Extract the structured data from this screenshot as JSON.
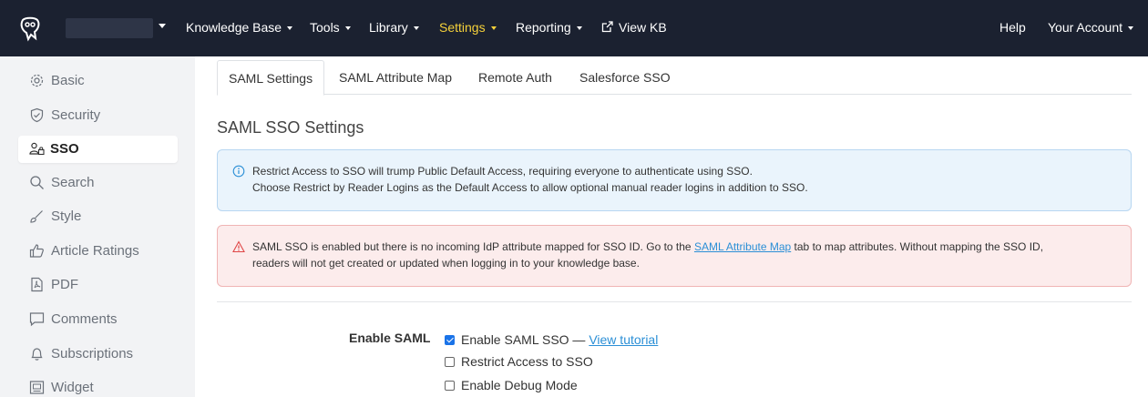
{
  "nav": {
    "items": [
      {
        "label": "Knowledge Base",
        "dropdown": true
      },
      {
        "label": "Tools",
        "dropdown": true
      },
      {
        "label": "Library",
        "dropdown": true
      },
      {
        "label": "Settings",
        "dropdown": true
      },
      {
        "label": "Reporting",
        "dropdown": true
      },
      {
        "label": "View KB",
        "icon": "external-link-icon"
      }
    ],
    "help": "Help",
    "account": "Your Account",
    "active_color": "#f5d13a",
    "background": "#1b2130"
  },
  "sidebar": {
    "items": [
      {
        "label": "Basic",
        "icon": "gear-icon"
      },
      {
        "label": "Security",
        "icon": "shield-check-icon"
      },
      {
        "label": "SSO",
        "icon": "users-lock-icon"
      },
      {
        "label": "Search",
        "icon": "search-icon"
      },
      {
        "label": "Style",
        "icon": "brush-icon"
      },
      {
        "label": "Article Ratings",
        "icon": "thumbs-up-icon"
      },
      {
        "label": "PDF",
        "icon": "pdf-icon"
      },
      {
        "label": "Comments",
        "icon": "comment-icon"
      },
      {
        "label": "Subscriptions",
        "icon": "bell-icon"
      },
      {
        "label": "Widget",
        "icon": "widget-icon"
      }
    ],
    "active": "SSO"
  },
  "tabs": [
    {
      "label": "SAML Settings"
    },
    {
      "label": "SAML Attribute Map"
    },
    {
      "label": "Remote Auth"
    },
    {
      "label": "Salesforce SSO"
    }
  ],
  "page": {
    "title": "SAML SSO Settings"
  },
  "info_alert": {
    "line1": "Restrict Access to SSO will trump Public Default Access, requiring everyone to authenticate using SSO.",
    "line2": "Choose Restrict by Reader Logins as the Default Access to allow optional manual reader logins in addition to SSO."
  },
  "danger_alert": {
    "line1_before": "SAML SSO is enabled but there is no incoming IdP attribute mapped for SSO ID. Go to the ",
    "link": "SAML Attribute Map",
    "line1_after": " tab to map attributes. Without mapping the SSO ID,",
    "line2": "readers will not get created or updated when logging in to your knowledge base."
  },
  "form": {
    "enable_label": "Enable SAML",
    "options": [
      {
        "label": "Enable SAML SSO — ",
        "link": "View tutorial",
        "checked": true
      },
      {
        "label": "Restrict Access to SSO",
        "checked": false
      },
      {
        "label": "Enable Debug Mode",
        "checked": false
      }
    ]
  }
}
